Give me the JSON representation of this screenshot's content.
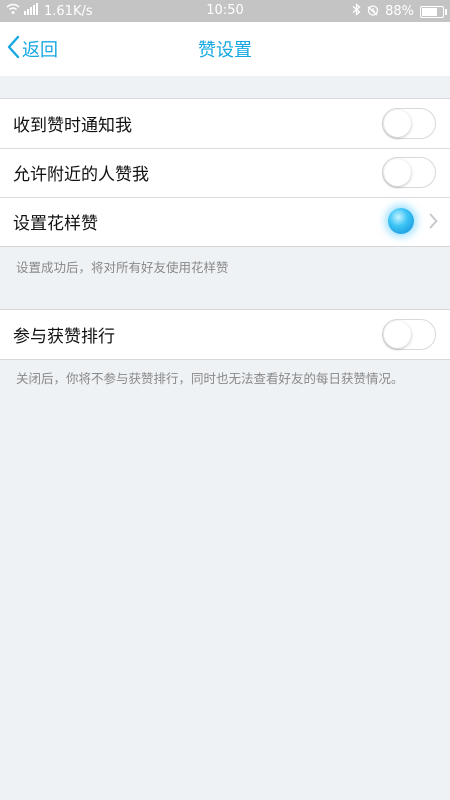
{
  "status_bar": {
    "network": "1.61K/s",
    "time": "10:50",
    "battery": "88%",
    "battery_level": 0.88
  },
  "nav": {
    "back_label": "返回",
    "title": "赞设置"
  },
  "group1": {
    "rows": [
      {
        "label": "收到赞时通知我",
        "toggle": false
      },
      {
        "label": "允许附近的人赞我",
        "toggle": false
      },
      {
        "label": "设置花样赞"
      }
    ],
    "note": "设置成功后，将对所有好友使用花样赞"
  },
  "group2": {
    "rows": [
      {
        "label": "参与获赞排行",
        "toggle": false
      }
    ],
    "note": "关闭后，你将不参与获赞排行，同时也无法查看好友的每日获赞情况。"
  },
  "colors": {
    "accent": "#17a8e3",
    "background": "#eff2f5"
  },
  "icons": [
    "back-chevron-icon",
    "bluetooth-icon",
    "alarm-icon",
    "battery-icon",
    "chevron-right-icon",
    "sparkle-orb-icon"
  ]
}
